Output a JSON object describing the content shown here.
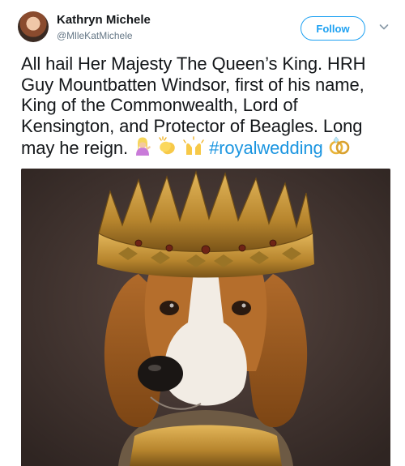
{
  "tweet": {
    "author_name": "Kathryn Michele",
    "author_handle": "@MlleKatMichele",
    "follow_label": "Follow",
    "text_lines": [
      "All hail Her Majesty The Queen’s King. HRH",
      "Guy Mountbatten Windsor, first of his name,",
      "King of the Commonwealth, Lord of",
      "Kensington, and Protector of Beagles. Long"
    ],
    "last_line_text": "may he reign.",
    "emojis": [
      "person-tipping-hand-emoji",
      "clapping-hands-emoji",
      "raising-hands-emoji",
      "rings-emoji"
    ],
    "hashtag": "#royalwedding",
    "media": {
      "subject": "beagle-wearing-crown-image"
    }
  },
  "colors": {
    "accent": "#1da1f2",
    "hashtag": "#1b95e0",
    "secondary_text": "#657786",
    "primary_text": "#14171a"
  }
}
